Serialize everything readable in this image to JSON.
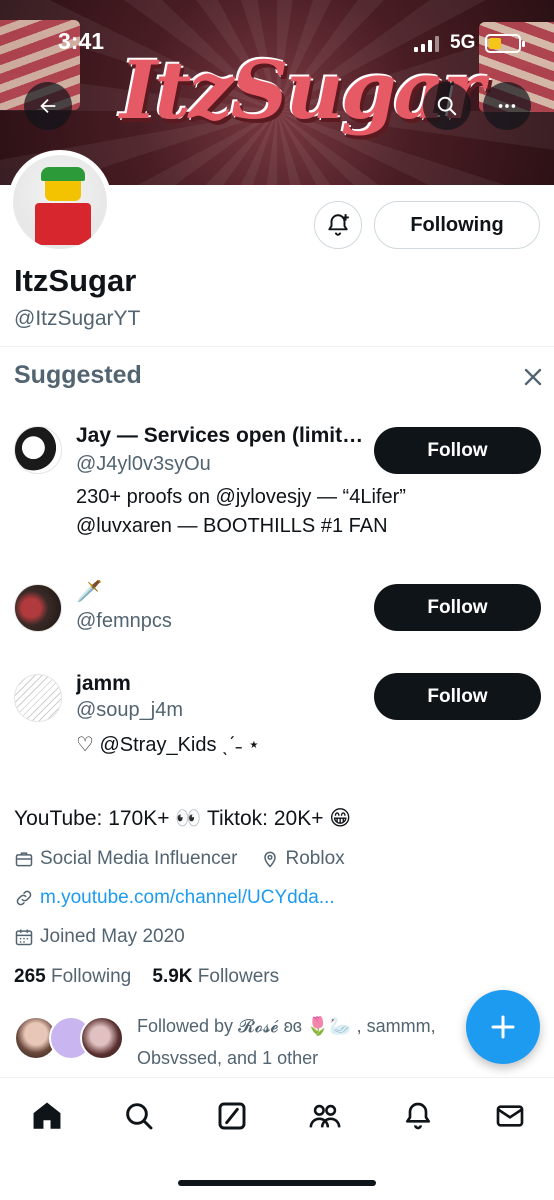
{
  "status": {
    "time": "3:41",
    "network": "5G"
  },
  "banner": {
    "logo_text": "ItzSugar"
  },
  "profile": {
    "display_name": "ItzSugar",
    "handle": "@ItzSugarYT",
    "following_label": "Following",
    "bio": "YouTube: 170K+ 👀 Tiktok: 20K+ 😁",
    "category": "Social Media Influencer",
    "location": "Roblox",
    "link": "m.youtube.com/channel/UCYdda...",
    "joined": "Joined May 2020",
    "following_count": "265",
    "following_text": "Following",
    "followers_count": "5.9K",
    "followers_text": "Followers",
    "followed_by": "Followed by 𝓡𝓸𝓼𝓮́ ʚɞ 🌷🦢 , sammm, Obsvssed, and 1 other"
  },
  "suggested": {
    "title": "Suggested",
    "follow_label": "Follow",
    "items": [
      {
        "name": "Jay — Services open (limit…",
        "handle": "@J4yl0v3syOu",
        "bio": "230+ proofs on @jylovesjy — “4Lifer” @luvxaren — BOOTHILLS #1 FAN"
      },
      {
        "name": "🗡️",
        "handle": "@femnpcs",
        "bio": ""
      },
      {
        "name": "jamm",
        "handle": "@soup_j4m",
        "bio": "♡ @Stray_Kids ˎˊ˗ ⋆"
      }
    ]
  },
  "colors": {
    "accent": "#1d9bf0",
    "text": "#0f1419",
    "secondary": "#536471"
  },
  "icons": [
    "back-arrow-icon",
    "search-icon",
    "more-icon",
    "bell-plus-icon",
    "close-icon",
    "briefcase-icon",
    "location-icon",
    "link-icon",
    "calendar-icon",
    "plus-icon",
    "home-icon",
    "explore-icon",
    "grok-icon",
    "communities-icon",
    "notifications-icon",
    "messages-icon"
  ]
}
